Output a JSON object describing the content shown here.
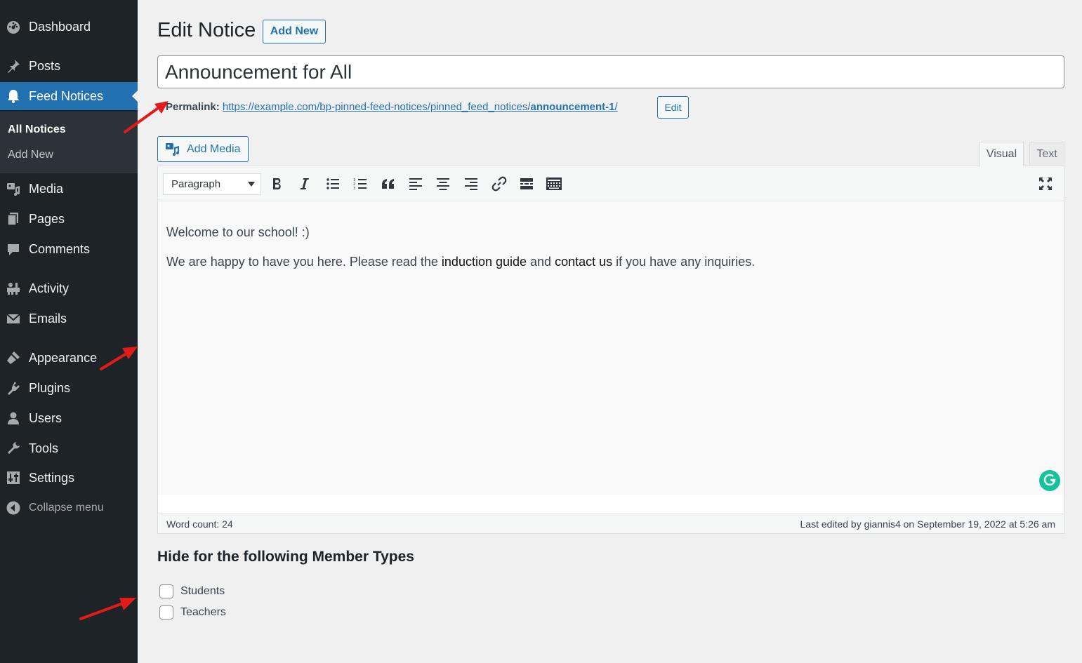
{
  "sidebar": {
    "items": [
      {
        "label": "Dashboard",
        "icon": "dashboard-icon"
      },
      {
        "label": "Posts",
        "icon": "pin-icon"
      },
      {
        "label": "Feed Notices",
        "icon": "bell-icon"
      },
      {
        "label": "Media",
        "icon": "media-icon"
      },
      {
        "label": "Pages",
        "icon": "pages-icon"
      },
      {
        "label": "Comments",
        "icon": "comment-icon"
      },
      {
        "label": "Activity",
        "icon": "activity-icon"
      },
      {
        "label": "Emails",
        "icon": "email-icon"
      },
      {
        "label": "Appearance",
        "icon": "appearance-icon"
      },
      {
        "label": "Plugins",
        "icon": "plugins-icon"
      },
      {
        "label": "Users",
        "icon": "users-icon"
      },
      {
        "label": "Tools",
        "icon": "wrench-icon"
      },
      {
        "label": "Settings",
        "icon": "settings-icon"
      }
    ],
    "submenu": [
      {
        "label": "All Notices"
      },
      {
        "label": "Add New"
      }
    ],
    "collapse_label": "Collapse menu"
  },
  "header": {
    "title": "Edit Notice",
    "add_new_label": "Add New"
  },
  "post": {
    "title": "Announcement for All",
    "permalink_label": "Permalink:",
    "permalink_base": "https://example.com/bp-pinned-feed-notices/pinned_feed_notices/",
    "permalink_slug": "announcement-1",
    "permalink_trail": "/",
    "permalink_edit_label": "Edit"
  },
  "editor": {
    "add_media_label": "Add Media",
    "tabs": [
      {
        "label": "Visual",
        "active": true
      },
      {
        "label": "Text",
        "active": false
      }
    ],
    "format_value": "Paragraph",
    "toolbar_buttons": [
      "bold",
      "italic",
      "bulleted-list",
      "numbered-list",
      "blockquote",
      "align-left",
      "align-center",
      "align-right",
      "insert-link",
      "read-more",
      "toolbar-toggle",
      "fullscreen"
    ],
    "content": {
      "para1": "Welcome to our school! :)",
      "para2_start": "We are happy to have you here. Please read the ",
      "link1": "induction guide",
      "para2_mid": " and ",
      "link2": "contact us",
      "para2_end": " if you have any inquiries."
    },
    "word_count": "Word count: 24",
    "last_edited": "Last edited by giannis4 on September 19, 2022 at 5:26 am"
  },
  "member_types": {
    "heading": "Hide for the following Member Types",
    "options": [
      {
        "label": "Students",
        "checked": false
      },
      {
        "label": "Teachers",
        "checked": false
      }
    ]
  },
  "colors": {
    "sidebar_bg": "#1d2327",
    "accent": "#2271b1",
    "annotation_arrow": "#e31a1a",
    "grammarly": "#15c39a"
  }
}
